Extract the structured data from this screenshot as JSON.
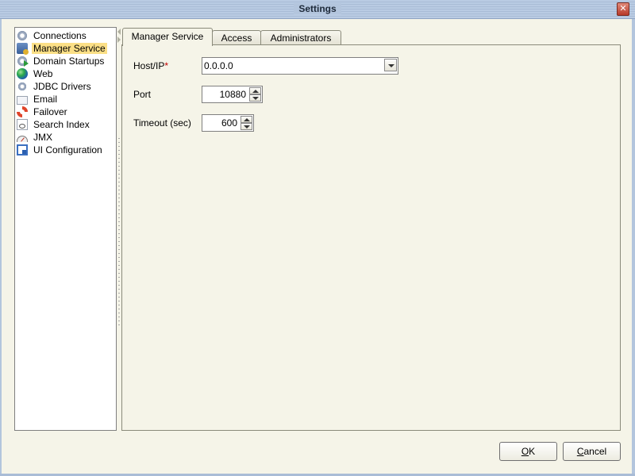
{
  "window": {
    "title": "Settings",
    "close_icon": "close-icon"
  },
  "sidebar": {
    "items": [
      {
        "label": "Connections",
        "icon": "gear-icon",
        "selected": false
      },
      {
        "label": "Manager Service",
        "icon": "server-icon",
        "selected": true
      },
      {
        "label": "Domain Startups",
        "icon": "gear-play-icon",
        "selected": false
      },
      {
        "label": "Web",
        "icon": "globe-icon",
        "selected": false
      },
      {
        "label": "JDBC Drivers",
        "icon": "gears-icon",
        "selected": false
      },
      {
        "label": "Email",
        "icon": "envelope-icon",
        "selected": false
      },
      {
        "label": "Failover",
        "icon": "lifebuoy-icon",
        "selected": false
      },
      {
        "label": "Search Index",
        "icon": "search-document-icon",
        "selected": false
      },
      {
        "label": "JMX",
        "icon": "gauge-icon",
        "selected": false
      },
      {
        "label": "UI Configuration",
        "icon": "ui-config-icon",
        "selected": false
      }
    ]
  },
  "tabs": [
    {
      "label": "Manager Service",
      "active": true
    },
    {
      "label": "Access",
      "active": false
    },
    {
      "label": "Administrators",
      "active": false
    }
  ],
  "form": {
    "host": {
      "label": "Host/IP",
      "required_mark": "*",
      "value": "0.0.0.0"
    },
    "port": {
      "label": "Port",
      "value": "10880"
    },
    "timeout": {
      "label": "Timeout (sec)",
      "value": "600"
    }
  },
  "buttons": {
    "ok": {
      "mnemonic": "O",
      "rest": "K"
    },
    "cancel": {
      "mnemonic": "C",
      "rest": "ancel"
    }
  }
}
